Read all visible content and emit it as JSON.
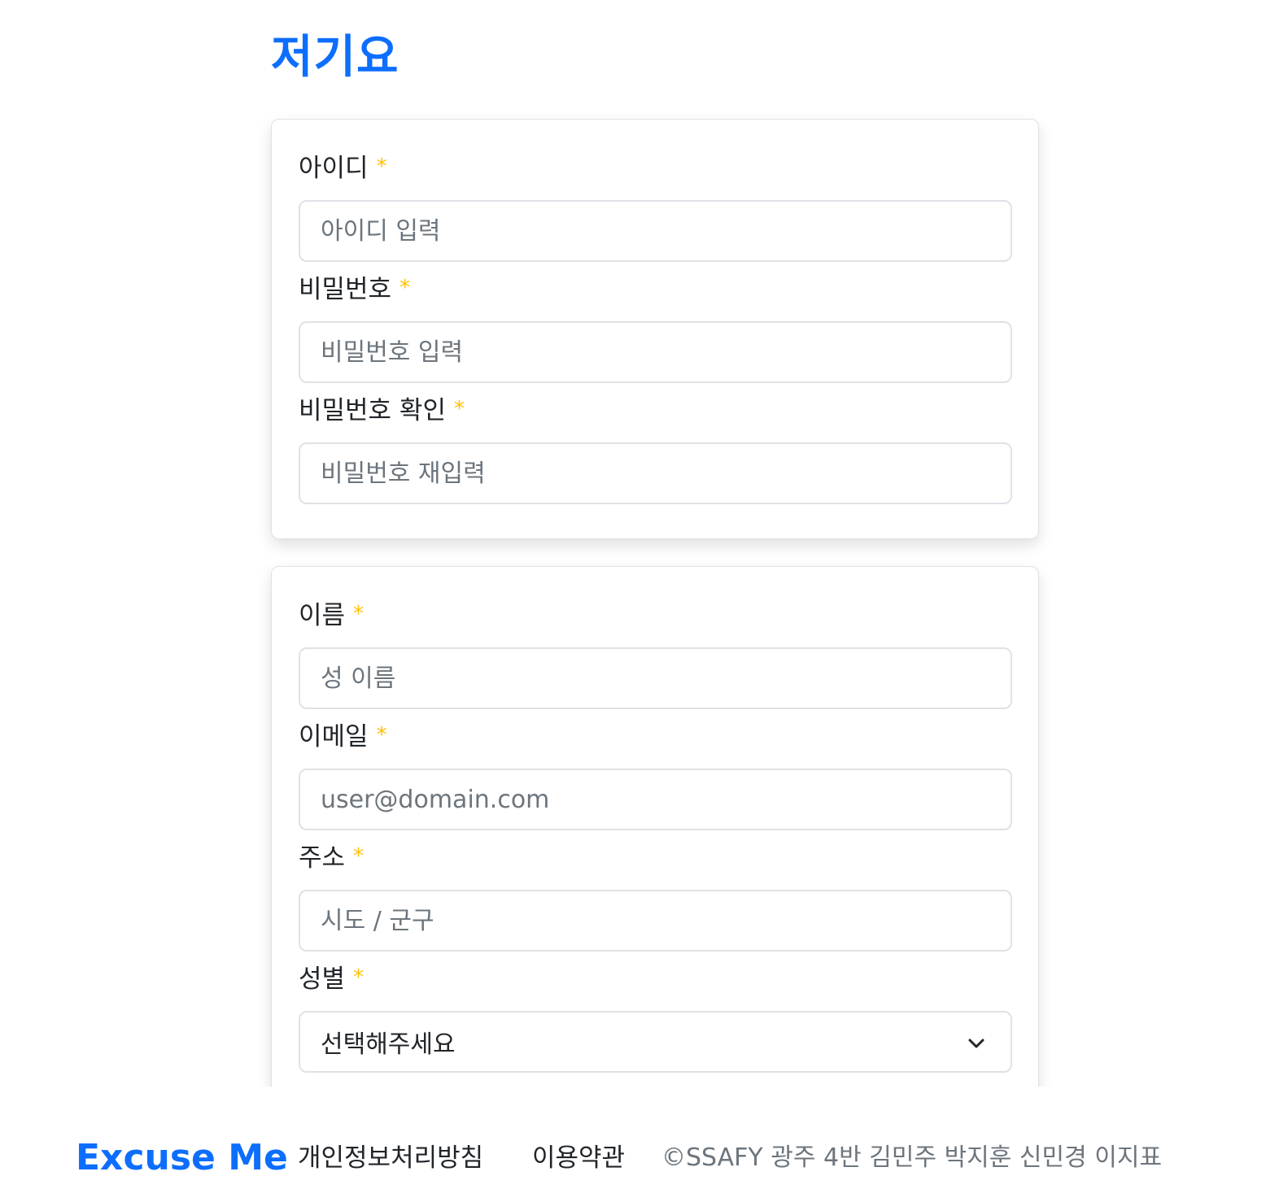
{
  "header": {
    "logo": "저기요"
  },
  "account_card": {
    "id": {
      "label": "아이디",
      "required_mark": "*",
      "placeholder": "아이디 입력"
    },
    "password": {
      "label": "비밀번호",
      "required_mark": "*",
      "placeholder": "비밀번호 입력"
    },
    "password_confirm": {
      "label": "비밀번호 확인",
      "required_mark": "*",
      "placeholder": "비밀번호 재입력"
    }
  },
  "profile_card": {
    "name": {
      "label": "이름",
      "required_mark": "*",
      "placeholder": "성 이름"
    },
    "email": {
      "label": "이메일",
      "required_mark": "*",
      "placeholder": "user@domain.com"
    },
    "address": {
      "label": "주소",
      "required_mark": "*",
      "placeholder": "시도 / 군구"
    },
    "gender": {
      "label": "성별",
      "required_mark": "*",
      "selected": "선택해주세요"
    }
  },
  "footer": {
    "brand": "Excuse Me",
    "privacy_link": "개인정보처리방침",
    "terms_link": "이용약관",
    "copyright": "©SSAFY 광주 4반 김민주 박지훈 신민경 이지표"
  },
  "colors": {
    "brand": "#0d6efd",
    "required": "#ffc107",
    "border": "#dee2e6",
    "placeholder": "#6c757d"
  },
  "icons": {
    "select_arrow": "chevron-down-icon"
  }
}
